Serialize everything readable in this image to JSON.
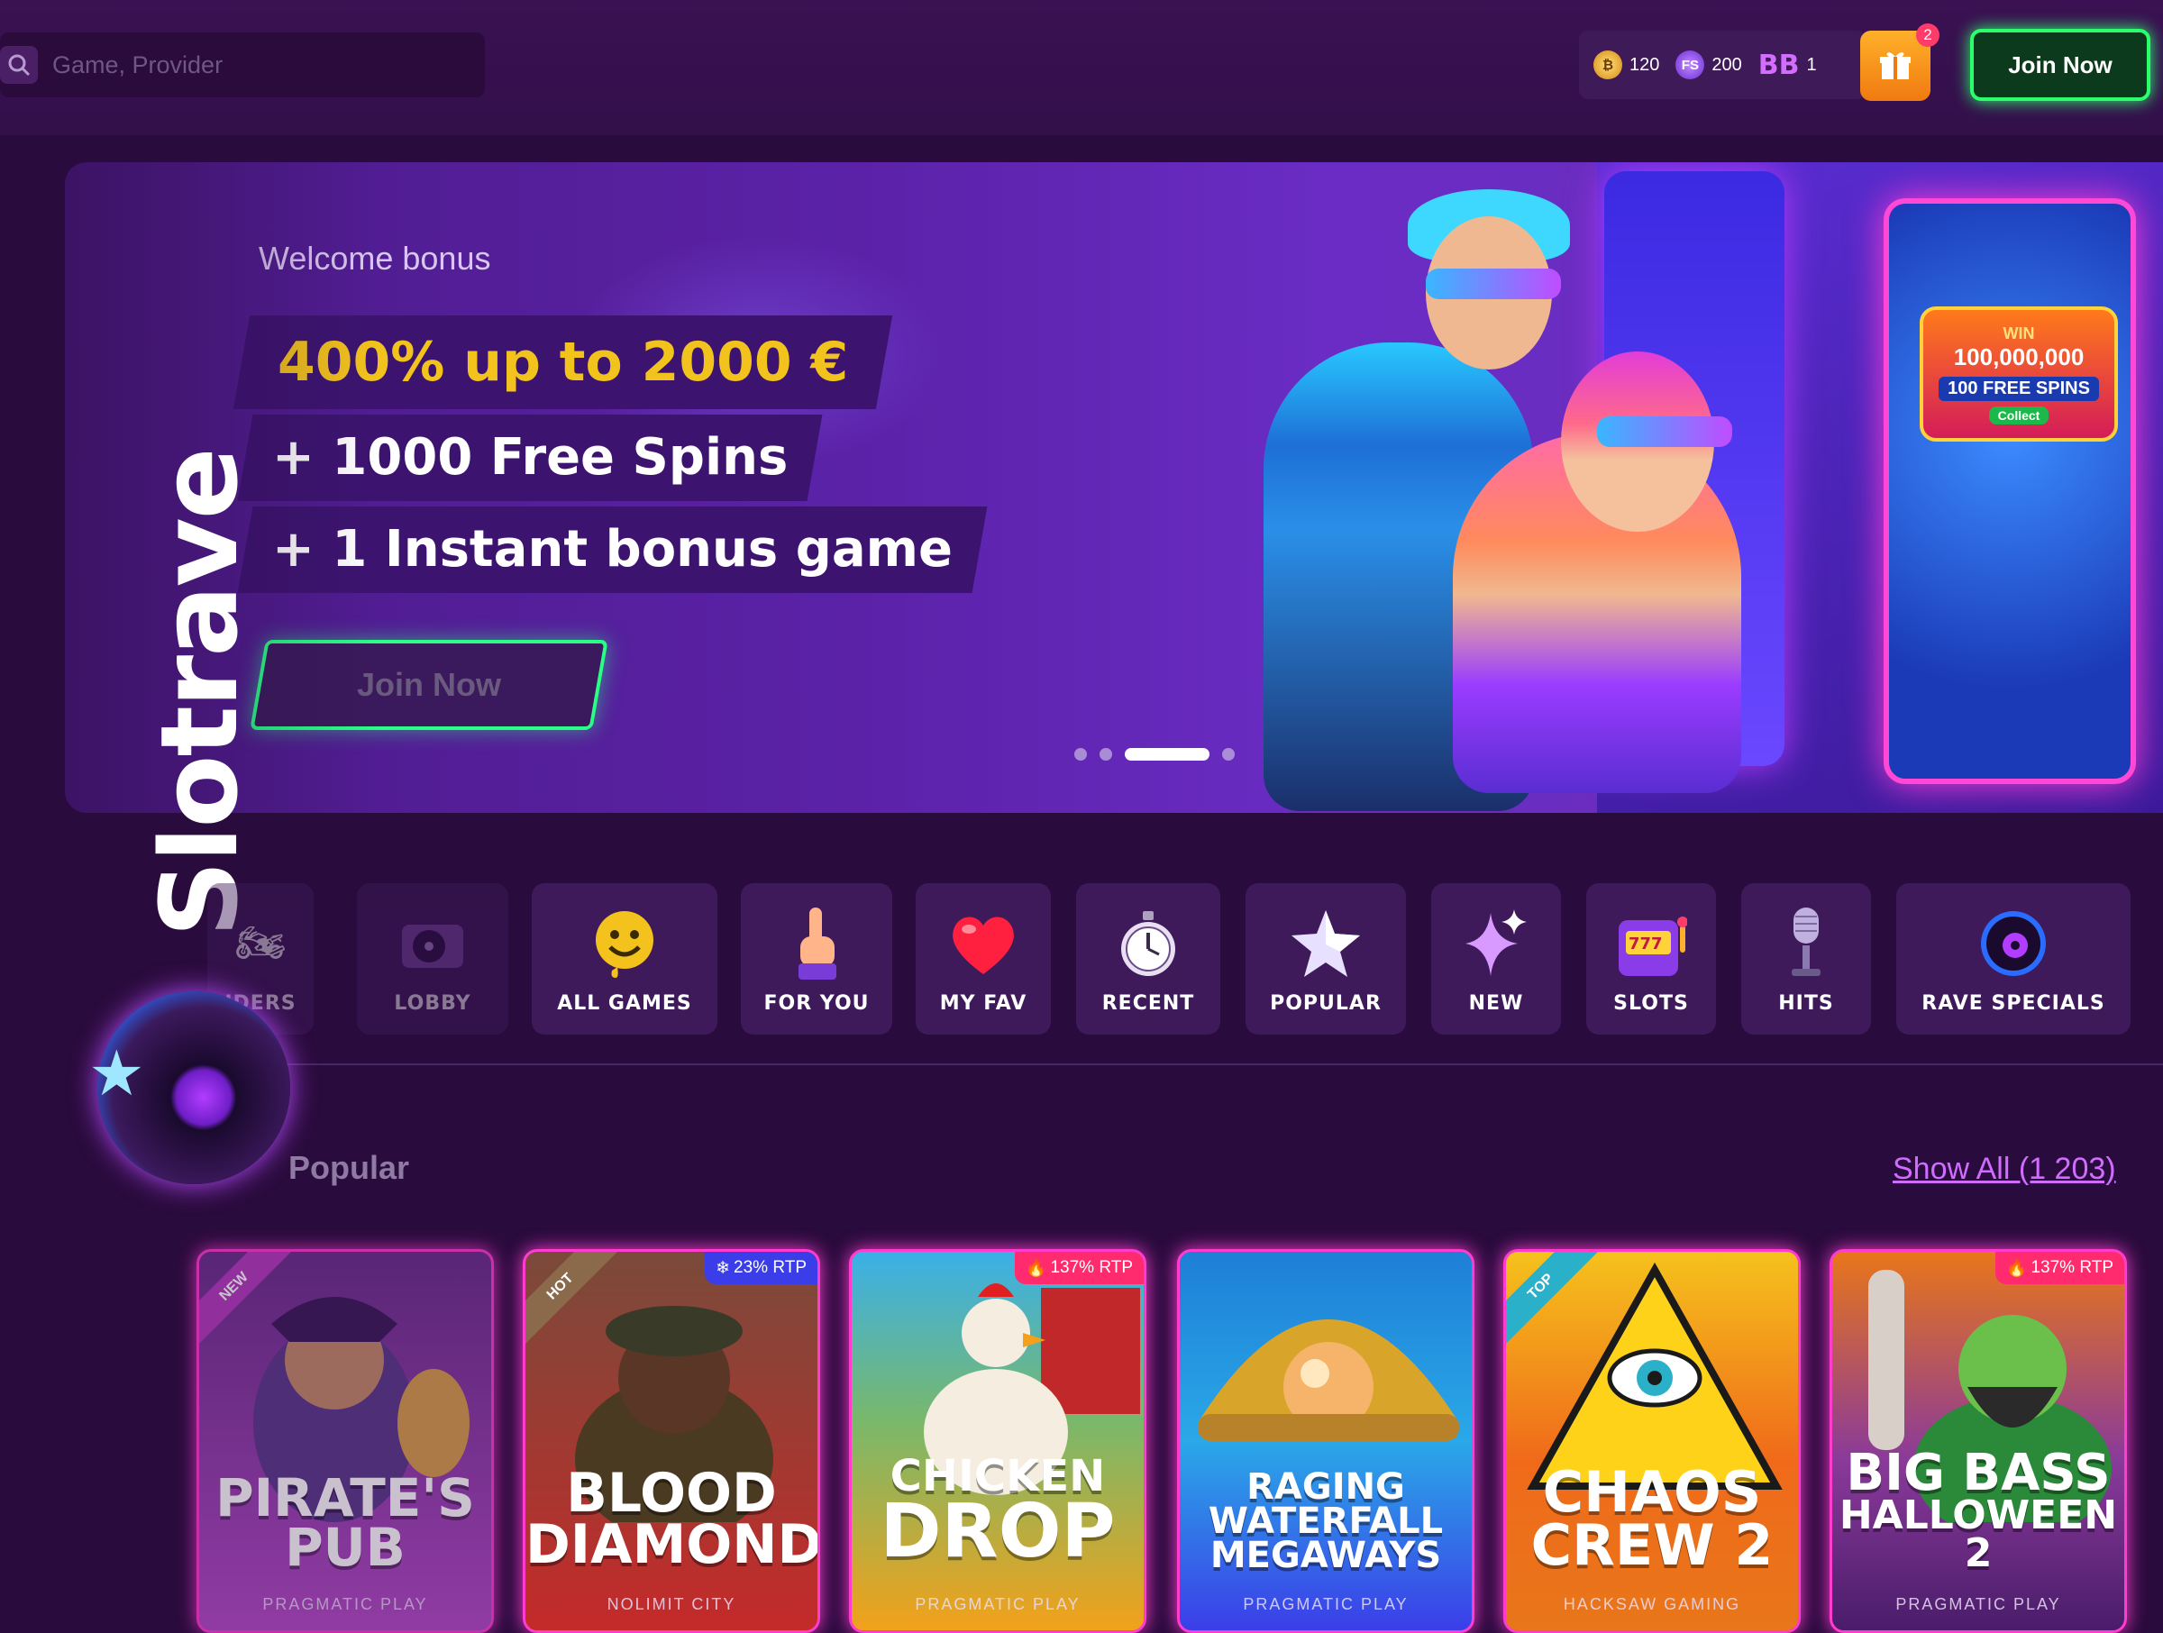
{
  "header": {
    "search_placeholder": "Game, Provider",
    "balances": [
      {
        "icon": "gold-coin-icon",
        "value": "120",
        "color": "#f5b51c"
      },
      {
        "icon": "free-spins-icon",
        "label": "FS",
        "value": "200",
        "color": "#9b4cff"
      },
      {
        "icon": "bonus-buy-icon",
        "label": "BB",
        "value": "1",
        "color": "#d46cff"
      }
    ],
    "gift_count": "2",
    "join_label": "Join Now"
  },
  "hero": {
    "welcome": "Welcome bonus",
    "line1": "400% up to 2000 €",
    "line2": "+ 1000 Free Spins",
    "line3": "+ 1 Instant bonus game",
    "cta": "Join Now",
    "slot_win_label": "WIN",
    "slot_win_amount": "100,000,000",
    "slot_free_spins": "100 FREE SPINS",
    "slot_collect": "Collect",
    "slides": 4,
    "active_slide": 3
  },
  "brand": {
    "logo_text": "Slotrave"
  },
  "categories": [
    {
      "label": "IDERS",
      "icon": "riders-icon",
      "dim": true
    },
    {
      "label": "LOBBY",
      "icon": "turntable-icon",
      "dim": true
    },
    {
      "label": "ALL GAMES",
      "icon": "smiley-icon"
    },
    {
      "label": "FOR YOU",
      "icon": "pointing-finger-icon"
    },
    {
      "label": "MY FAV",
      "icon": "heart-icon"
    },
    {
      "label": "RECENT",
      "icon": "stopwatch-icon"
    },
    {
      "label": "POPULAR",
      "icon": "star-icon"
    },
    {
      "label": "NEW",
      "icon": "sparkle-icon"
    },
    {
      "label": "SLOTS",
      "icon": "slot-machine-icon"
    },
    {
      "label": "HITS",
      "icon": "microphone-icon"
    },
    {
      "label": "RAVE SPECIALS",
      "icon": "vinyl-icon"
    }
  ],
  "section": {
    "title": "Popular",
    "show_all": "Show All (1 203)"
  },
  "games": [
    {
      "title_lines": [
        "PIRATE'S",
        "PUB"
      ],
      "provider": "PRAGMATIC PLAY",
      "ribbon": "NEW",
      "rtp": null,
      "colors": [
        "#6a2f8a",
        "#b34cc6"
      ]
    },
    {
      "title_lines": [
        "BLOOD",
        "DIAMOND"
      ],
      "provider": "NOLIMIT CITY",
      "ribbon": "HOT",
      "rtp": "23% RTP",
      "rtp_type": "cold",
      "colors": [
        "#5a2a1c",
        "#c42a2a"
      ]
    },
    {
      "title_lines": [
        "CHICKEN",
        "DROP"
      ],
      "provider": "PRAGMATIC PLAY",
      "ribbon": null,
      "rtp": "137% RTP",
      "rtp_type": "hot",
      "colors": [
        "#3ab0e8",
        "#f2a11a"
      ]
    },
    {
      "title_lines": [
        "RAGING",
        "WATERFALL",
        "MEGAWAYS"
      ],
      "provider": "PRAGMATIC PLAY",
      "ribbon": null,
      "rtp": null,
      "colors": [
        "#1e7fd6",
        "#3b3ee8"
      ]
    },
    {
      "title_lines": [
        "CHAOS",
        "CREW 2"
      ],
      "provider": "HACKSAW GAMING",
      "ribbon": "TOP",
      "rtp": null,
      "colors": [
        "#f06a1a",
        "#e8a11a"
      ]
    },
    {
      "title_lines": [
        "BIG BASS",
        "HALLOWEEN 2"
      ],
      "provider": "PRAGMATIC PLAY",
      "ribbon": null,
      "rtp": "137% RTP",
      "rtp_type": "hot",
      "colors": [
        "#8a3a9a",
        "#4a1c6a"
      ]
    }
  ]
}
